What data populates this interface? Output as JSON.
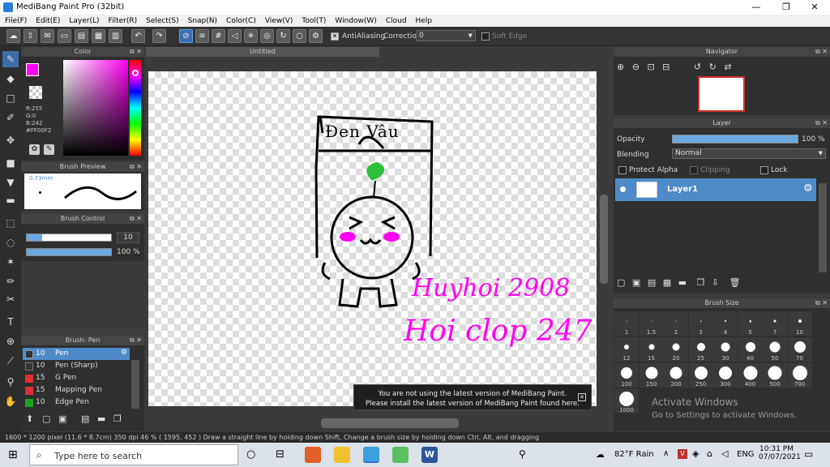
{
  "app": {
    "title": "MediBang Paint Pro (32bit)"
  },
  "menu": [
    "File(F)",
    "Edit(E)",
    "Layer(L)",
    "Filter(R)",
    "Select(S)",
    "Snap(N)",
    "Color(C)",
    "View(V)",
    "Tool(T)",
    "Window(W)",
    "Cloud",
    "Help"
  ],
  "toolbar": {
    "antialias_label": "AntiAliasing",
    "correction_label": "Correction",
    "correction_value": "0",
    "soft_edge_label": "Soft Edge"
  },
  "color_panel": {
    "header": "Color",
    "r": "R:255",
    "g": "G:0",
    "b": "B:242",
    "hex": "#FF00F2",
    "primary": "#ff00f2"
  },
  "brush_preview": {
    "header": "Brush Preview",
    "size": "0.73mm"
  },
  "brush_control": {
    "header": "Brush Control",
    "size_value": "10",
    "opacity_value": "100 %"
  },
  "brush_list": {
    "header": "Brush: Pen",
    "items": [
      {
        "size": "10",
        "name": "Pen",
        "color": "#333333"
      },
      {
        "size": "10",
        "name": "Pen (Sharp)",
        "color": "#333333"
      },
      {
        "size": "15",
        "name": "G Pen",
        "color": "#e03030"
      },
      {
        "size": "15",
        "name": "Mapping Pen",
        "color": "#e03030"
      },
      {
        "size": "10",
        "name": "Edge Pen",
        "color": "#20a020"
      }
    ]
  },
  "canvas": {
    "tab": "Untitled",
    "text_top": "Đen Vâu",
    "text_hw1": "Huyhoi 2908",
    "text_hw2": "Hoi clop 247"
  },
  "notice": {
    "line1": "You are not using the latest version of MediBang Paint.",
    "line2": "Please install the latest version of MediBang Paint found here."
  },
  "navigator": {
    "header": "Navigator"
  },
  "layer_panel": {
    "header": "Layer",
    "opacity_label": "Opacity",
    "opacity_value": "100 %",
    "opacity_fraction": 1.0,
    "blending_label": "Blending",
    "blending_value": "Normal",
    "protect_alpha": "Protect Alpha",
    "clipping": "Clipping",
    "lock": "Lock",
    "layer_name": "Layer1"
  },
  "brush_size": {
    "header": "Brush Size",
    "sizes": [
      "1",
      "1.5",
      "2",
      "3",
      "4",
      "5",
      "7",
      "10",
      "12",
      "15",
      "20",
      "25",
      "30",
      "40",
      "50",
      "70",
      "100",
      "150",
      "200",
      "250",
      "300",
      "400",
      "500",
      "700",
      "1000"
    ]
  },
  "status": {
    "text": "1600 * 1200 pixel   (11.6 * 8.7cm)   350 dpi   46 %   ( 1595, 452 )   Draw a straight line by holding down Shift, Change a brush size by holding down Ctrl, Alt, and dragging"
  },
  "watermark": {
    "line1": "Activate Windows",
    "line2": "Go to Settings to activate Windows."
  },
  "taskbar": {
    "search_placeholder": "Type here to search",
    "weather": "82°F  Rain",
    "lang": "ENG",
    "time": "10:31 PM",
    "date": "07/07/2021"
  }
}
